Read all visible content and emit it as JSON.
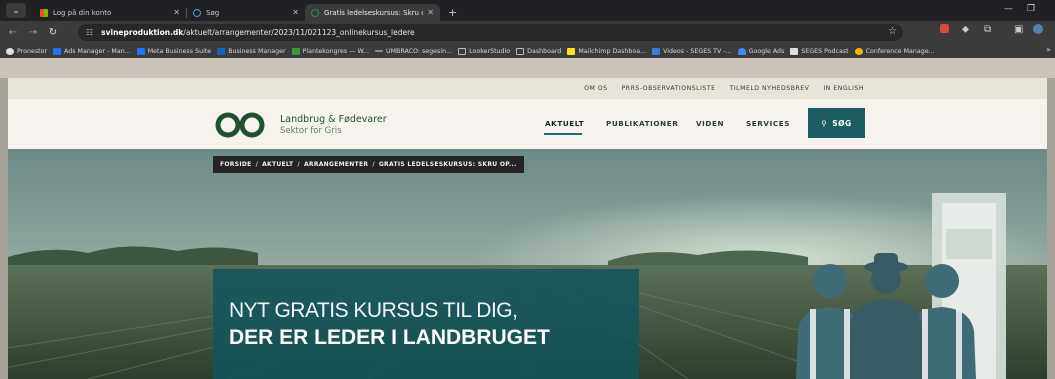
{
  "browser": {
    "tabs": [
      {
        "title": "Log på din konto",
        "active": false
      },
      {
        "title": "Søg",
        "active": false
      },
      {
        "title": "Gratis ledelseskursus: Skru op f…",
        "active": true
      }
    ],
    "url_domain": "svineproduktion.dk",
    "url_path": "/aktuelt/arrangementer/2023/11/021123_onlinekursus_ledere",
    "bookmarks": [
      {
        "label": "Pronestor",
        "icon_color": "#e0e0e0"
      },
      {
        "label": "Ads Manager - Man...",
        "icon_color": "#1877f2"
      },
      {
        "label": "Meta Business Suite",
        "icon_color": "#1877f2"
      },
      {
        "label": "Business Manager",
        "icon_color": "#0a66c2"
      },
      {
        "label": "Plantekongres — W...",
        "icon_color": "#2e9c3b"
      },
      {
        "label": "UMBRACO: segesin...",
        "icon_color": "#888888"
      },
      {
        "label": "LookerStudio",
        "icon_color": "#bbbbbb"
      },
      {
        "label": "Dashboard",
        "icon_color": "#bbbbbb"
      },
      {
        "label": "Mailchimp Dashboa...",
        "icon_color": "#ffe01b"
      },
      {
        "label": "Videos - SEGES TV -...",
        "icon_color": "#3a7bd5"
      },
      {
        "label": "Google Ads",
        "icon_color": "#4285f4"
      },
      {
        "label": "SEGES Podcast",
        "icon_color": "#dddddd"
      },
      {
        "label": "Conference Manage...",
        "icon_color": "#f2b705"
      }
    ]
  },
  "site": {
    "utility_links": [
      "OM OS",
      "PRRS-OBSERVATIONSLISTE",
      "TILMELD NYHEDSBREV",
      "IN ENGLISH"
    ],
    "brand_line1": "Landbrug & Fødevarer",
    "brand_line2": "Sektor for Gris",
    "nav": [
      "AKTUELT",
      "PUBLIKATIONER",
      "VIDEN",
      "SERVICES"
    ],
    "nav_active": "AKTUELT",
    "search_label": "SØG",
    "breadcrumb": [
      "FORSIDE",
      "AKTUELT",
      "ARRANGEMENTER",
      "GRATIS LEDELSESKURSUS: SKRU OP..."
    ],
    "hero_line1": "NYT GRATIS KURSUS TIL DIG,",
    "hero_line2": "DER ER LEDER I LANDBRUGET",
    "colors": {
      "brand_teal": "#1c5d64",
      "brand_green": "#1f5130",
      "utility_bg": "#e9e4d9"
    }
  }
}
